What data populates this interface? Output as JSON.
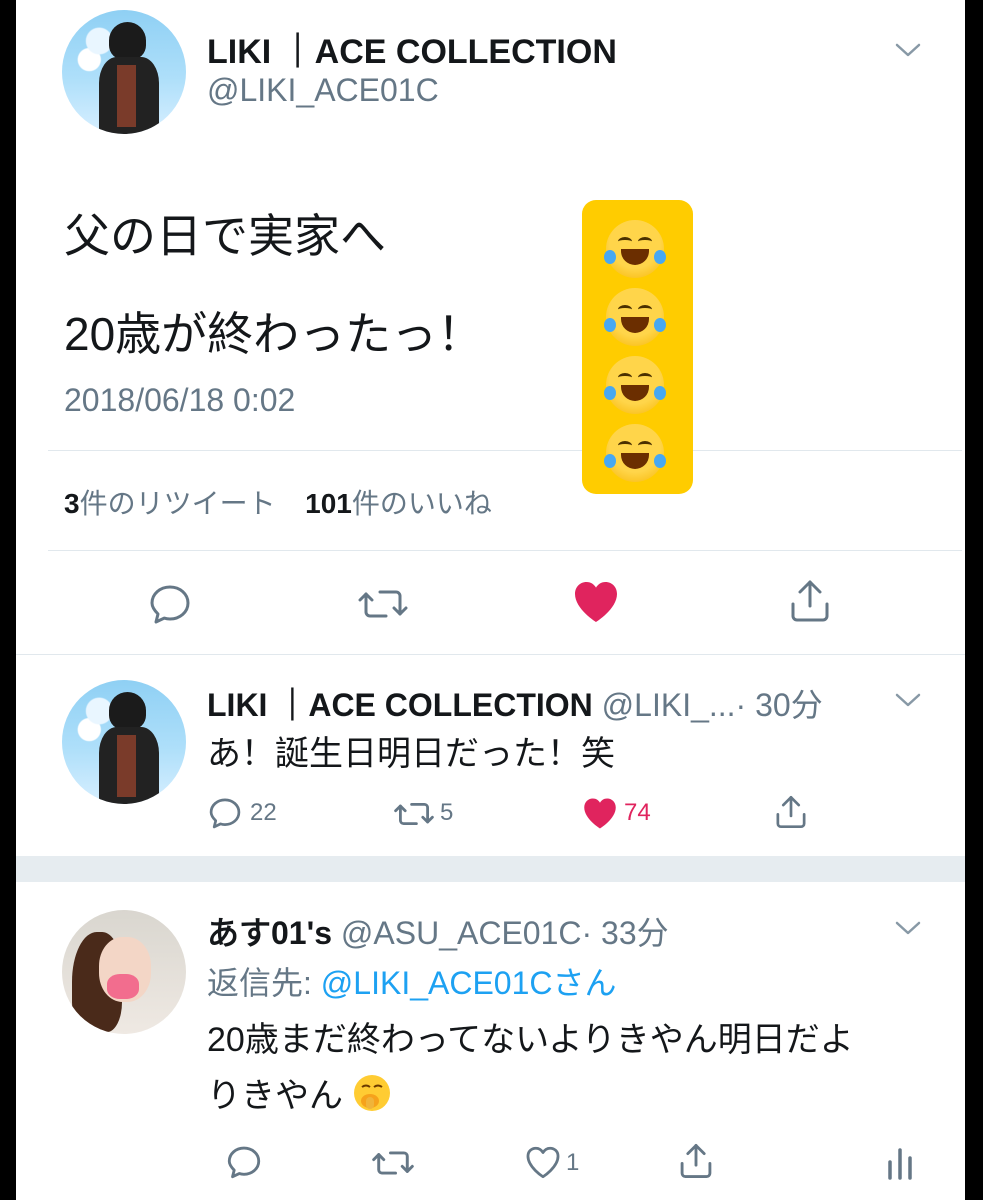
{
  "main_tweet": {
    "author_name": "LIKI ｜ACE COLLECTION",
    "handle": "@LIKI_ACE01C",
    "text_line1": "父の日で実家へ",
    "text_line2": "20歳が終わったっ！",
    "timestamp": "2018/06/18 0:02",
    "retweet_count": "3",
    "retweet_label": "件のリツイート",
    "like_count": "101",
    "like_label": "件のいいね",
    "emoji_overlay": [
      "face-with-tears-of-joy",
      "face-with-tears-of-joy",
      "face-with-tears-of-joy",
      "face-with-tears-of-joy"
    ]
  },
  "reply1": {
    "author_name": "LIKI ｜ACE COLLECTION",
    "handle": "@LIKI_...",
    "time": "· 30分",
    "text": "あ！誕生日明日だった！笑",
    "reply_count": "22",
    "retweet_count": "5",
    "like_count": "74"
  },
  "reply2": {
    "author_name": "あす01's",
    "handle": "@ASU_ACE01C",
    "time": "· 33分",
    "reply_to_prefix": "返信先: ",
    "reply_to_handle": "@LIKI_ACE01Cさん",
    "text_line1": "20歳まだ終わってないよりきやん明日だよ",
    "text_line2": "りきやん",
    "like_count": "1"
  },
  "colors": {
    "like_red": "#e0245e",
    "link_blue": "#1da1f2",
    "muted": "#657786",
    "emoji_panel": "#ffcc00"
  }
}
